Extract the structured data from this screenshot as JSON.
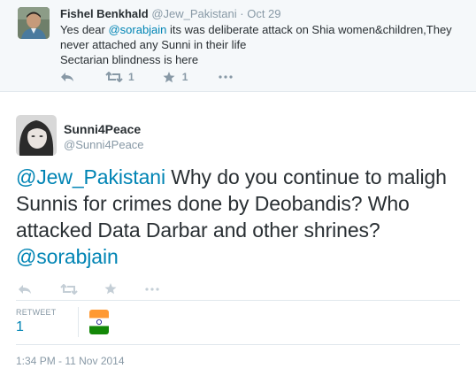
{
  "reply": {
    "author_name": "Fishel Benkhald",
    "author_handle": "@Jew_Pakistani",
    "separator": "·",
    "date": "Oct 29",
    "text_pre": "Yes dear ",
    "text_link": "@sorabjain",
    "text_post": " its was deliberate attack on Shia women&children,They never attached any Sunni in their life",
    "text_line2": "Sectarian blindness is here",
    "retweet_count": "1",
    "favorite_count": "1"
  },
  "tweet": {
    "author_name": "Sunni4Peace",
    "author_handle": "@Sunni4Peace",
    "text_mention1": "@Jew_Pakistani",
    "text_body": " Why do you continue to maligh Sunnis for crimes done by Deobandis? Who attacked Data Darbar and other shrines? ",
    "text_mention2": "@sorabjain",
    "stats": {
      "retweet_label": "RETWEET",
      "retweet_value": "1"
    },
    "timestamp": "1:34 PM - 11 Nov 2014"
  },
  "icons": {
    "reply": "reply-icon",
    "retweet": "retweet-icon",
    "favorite": "star-icon",
    "more": "more-icon"
  },
  "colors": {
    "link": "#0084b4",
    "muted": "#8899a6",
    "text": "#292f33",
    "reply_background": "#f5f8fa",
    "border": "#e1e8ed"
  }
}
